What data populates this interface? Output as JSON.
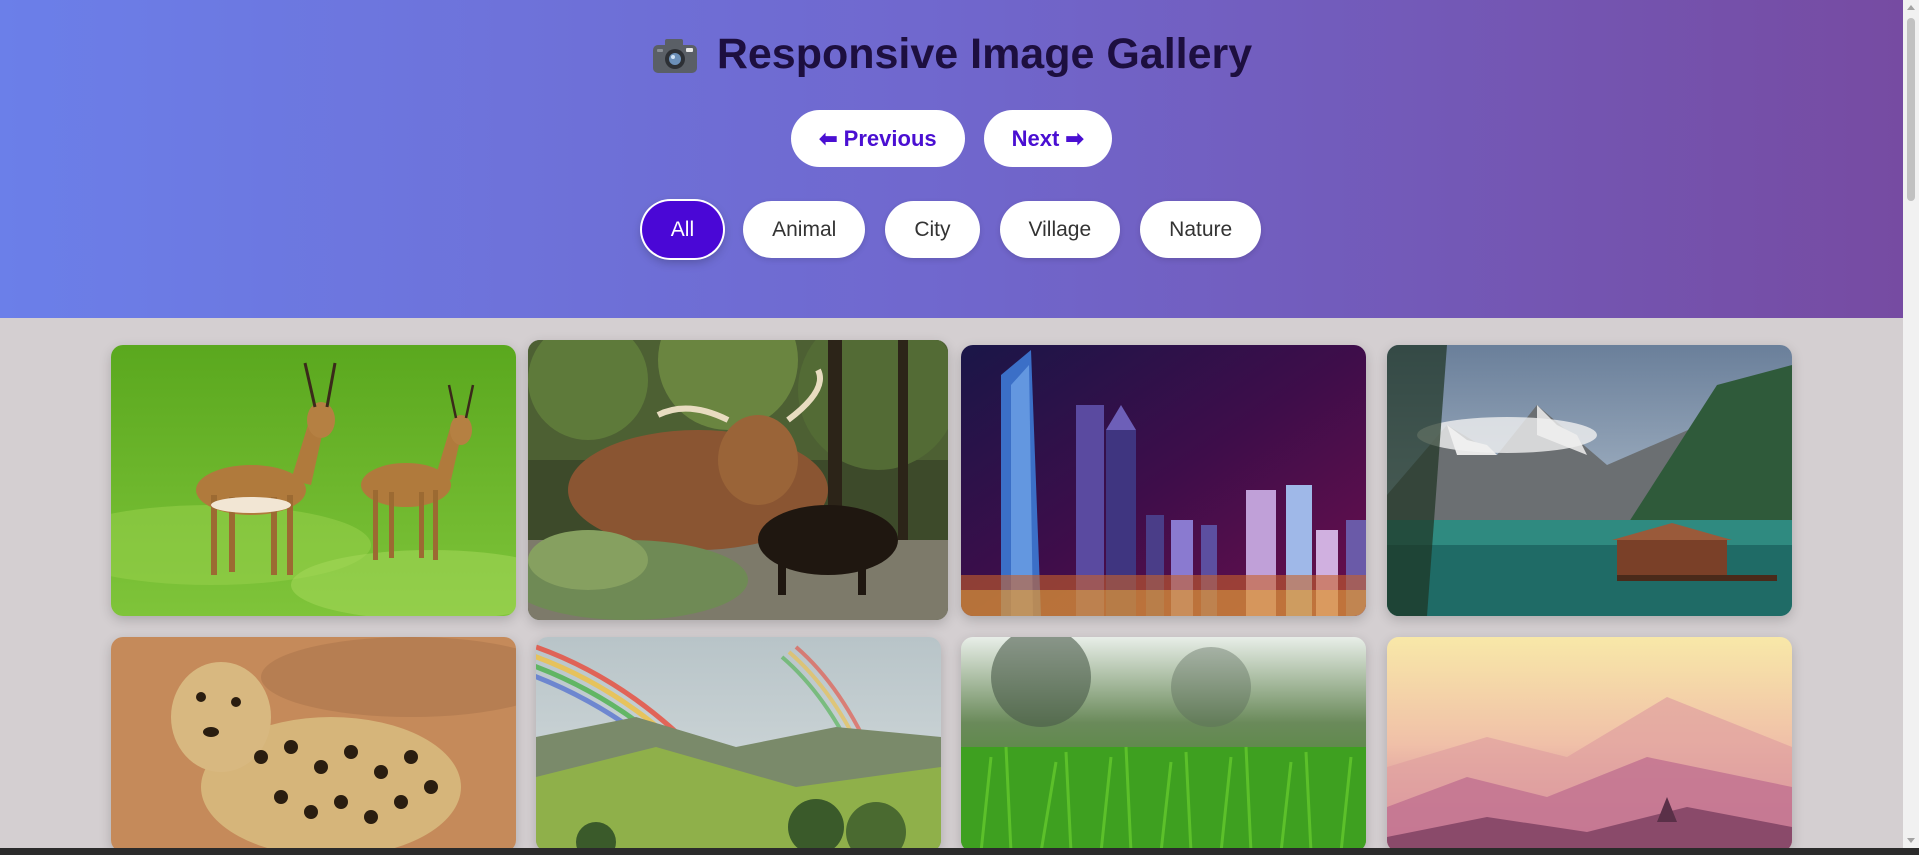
{
  "header": {
    "title": "Responsive Image Gallery",
    "title_icon": "camera-icon"
  },
  "navigation": {
    "previous_label": "⬅ Previous",
    "next_label": "Next ➡"
  },
  "filters": {
    "items": [
      "All",
      "Animal",
      "City",
      "Village",
      "Nature"
    ],
    "active": "All"
  },
  "gallery": {
    "images": [
      {
        "subject": "impalas on grass",
        "category": "Animal"
      },
      {
        "subject": "highland cattle in forest",
        "category": "Animal"
      },
      {
        "subject": "city skyline at night",
        "category": "City"
      },
      {
        "subject": "mountain lake with boathouse",
        "category": "Nature"
      },
      {
        "subject": "leopard",
        "category": "Animal"
      },
      {
        "subject": "rainbow over valley",
        "category": "Nature"
      },
      {
        "subject": "green grass close-up",
        "category": "Nature"
      },
      {
        "subject": "misty pink mountains",
        "category": "Nature"
      }
    ]
  },
  "colors": {
    "hero_gradient_start": "#6b7fe9",
    "hero_gradient_end": "#764ba2",
    "accent": "#4a07d6",
    "page_background": "#d4cfd1"
  }
}
